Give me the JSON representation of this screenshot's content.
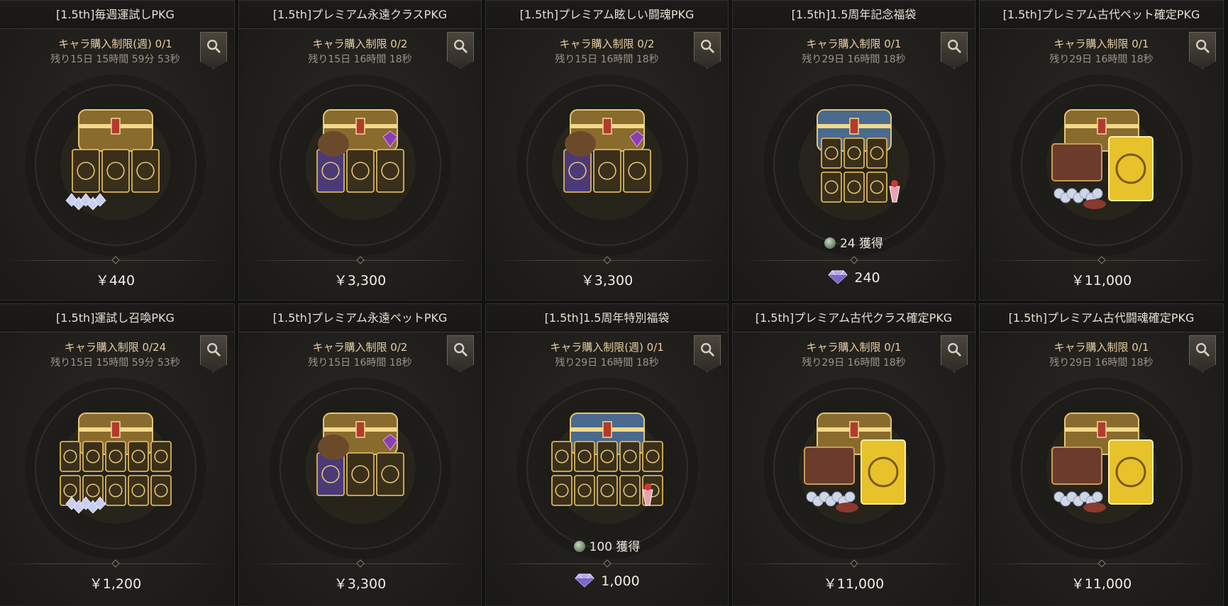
{
  "cards": [
    {
      "title": "[1.5th]毎週運試しPKG",
      "limit": "キャラ購入制限(週) 0/1",
      "remaining": "残り15日 15時間 59分 53秒",
      "bonus": "",
      "price": "￥440",
      "art": "chest-cards-gems",
      "price_type": "yen"
    },
    {
      "title": "[1.5th]プレミアム永遠クラスPKG",
      "limit": "キャラ購入制限 0/2",
      "remaining": "残り15日 16時間 18秒",
      "bonus": "",
      "price": "￥3,300",
      "art": "chest-class-cards",
      "price_type": "yen"
    },
    {
      "title": "[1.5th]プレミアム眩しい闘魂PKG",
      "limit": "キャラ購入制限 0/2",
      "remaining": "残り15日 16時間 18秒",
      "bonus": "",
      "price": "￥3,300",
      "art": "chest-soul-cards",
      "price_type": "yen"
    },
    {
      "title": "[1.5th]1.5周年記念福袋",
      "limit": "キャラ購入制限 0/1",
      "remaining": "残り29日 16時間 18秒",
      "bonus": "24 獲得",
      "price": "240",
      "art": "anniversary-bundle",
      "price_type": "gem"
    },
    {
      "title": "[1.5th]プレミアム古代ペット確定PKG",
      "limit": "キャラ購入制限 0/1",
      "remaining": "残り29日 16時間 18秒",
      "bonus": "",
      "price": "￥11,000",
      "art": "ancient-pet-bundle",
      "price_type": "yen"
    },
    {
      "title": "[1.5th]運試し召喚PKG",
      "limit": "キャラ購入制限 0/24",
      "remaining": "残り15日 15時間 59分 53秒",
      "bonus": "",
      "price": "￥1,200",
      "art": "summon-cards",
      "price_type": "yen"
    },
    {
      "title": "[1.5th]プレミアム永遠ペットPKG",
      "limit": "キャラ購入制限 0/2",
      "remaining": "残り15日 16時間 18秒",
      "bonus": "",
      "price": "￥3,300",
      "art": "chest-pet-cards",
      "price_type": "yen"
    },
    {
      "title": "[1.5th]1.5周年特別福袋",
      "limit": "キャラ購入制限(週) 0/1",
      "remaining": "残り29日 16時間 18秒",
      "bonus": "100 獲得",
      "price": "1,000",
      "art": "anniversary-special-bundle",
      "price_type": "gem"
    },
    {
      "title": "[1.5th]プレミアム古代クラス確定PKG",
      "limit": "キャラ購入制限 0/1",
      "remaining": "残り29日 16時間 18秒",
      "bonus": "",
      "price": "￥11,000",
      "art": "ancient-class-bundle",
      "price_type": "yen"
    },
    {
      "title": "[1.5th]プレミアム古代闘魂確定PKG",
      "limit": "キャラ購入制限 0/1",
      "remaining": "残り29日 16時間 18秒",
      "bonus": "",
      "price": "￥11,000",
      "art": "ancient-soul-bundle",
      "price_type": "yen"
    }
  ],
  "icons": {
    "zoom": "magnifier-icon",
    "gem": "diamond-gem-icon",
    "coin": "green-coin-icon"
  },
  "colors": {
    "gold": "#d9b45a",
    "limit_text": "#e7cfa0",
    "card_bg": "#23211e"
  }
}
